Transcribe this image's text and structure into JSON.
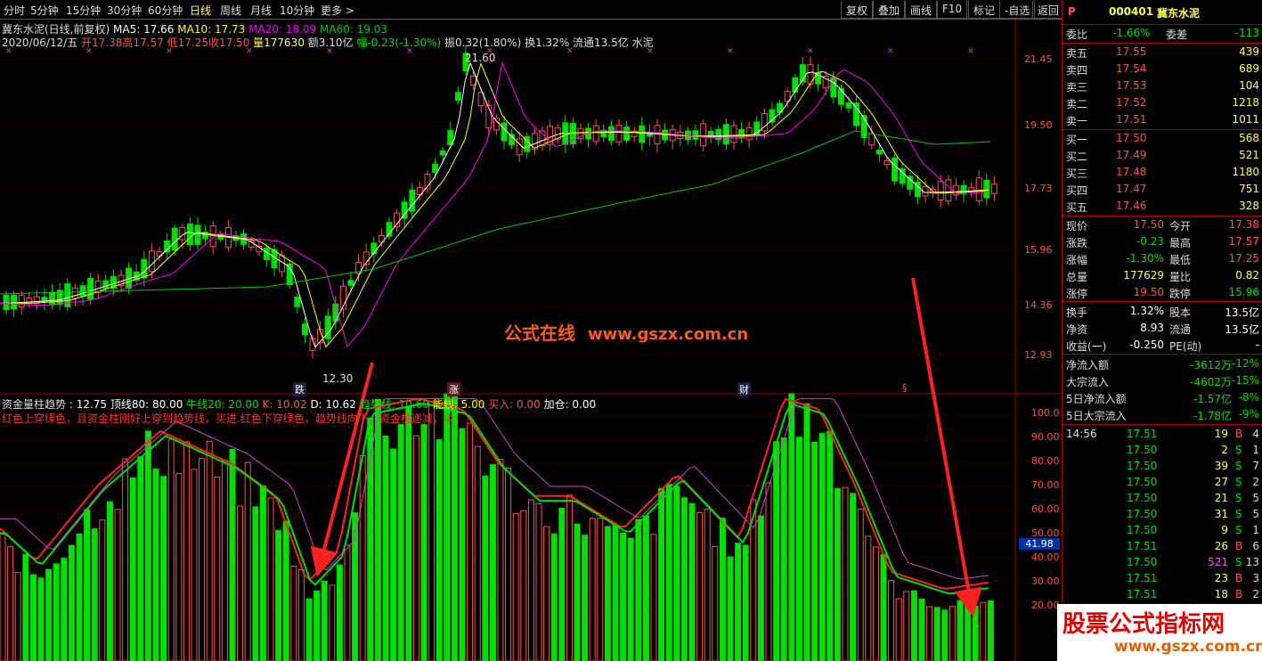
{
  "toolbar": {
    "tabs": [
      "分时",
      "5分钟",
      "15分钟",
      "30分钟",
      "60分钟",
      "日线",
      "周线",
      "月线",
      "10分钟",
      "更多 >"
    ],
    "active_tab": "日线",
    "right_buttons": [
      "复权",
      "叠加",
      "画线",
      "F10",
      "标记",
      "-自选",
      "返回"
    ]
  },
  "header": {
    "title": "冀东水泥(日线,前复权)",
    "ma5": "MA5: 17.66",
    "ma10": "MA10: 17.73",
    "ma20": "MA20: 18.09",
    "ma60": "MA60: 19.03",
    "date": "2020/06/12/五",
    "open": "开17.38",
    "high": "高17.57",
    "low": "低17.25",
    "close": "收17.50",
    "vol": "量177630",
    "amt": "额3.10亿",
    "chg": "幅-0.23(-1.30%)",
    "swing": "振0.32(1.80%)",
    "turnover": "换1.32%",
    "float": "流通13.5亿",
    "industry": "水泥"
  },
  "main_chart": {
    "y_ticks": [
      "21.45",
      "19.50",
      "17.73",
      "15.96",
      "14.36",
      "12.93"
    ],
    "high_label": "21.60",
    "low_label": "12.30",
    "events": [
      "跌",
      "涨",
      "财",
      "§"
    ],
    "colors": {
      "up": "#ff5050",
      "down": "#00e000",
      "ma5": "#ffffff",
      "ma10": "#ffff00",
      "ma20": "#ff00ff",
      "ma60": "#00cc00"
    }
  },
  "watermark_center": {
    "cn": "公式在线",
    "url": "www.gszx.com.cn"
  },
  "indicator": {
    "name": "资金量柱趋势",
    "v1": ": 12.75",
    "top": "顶线80: 80.00",
    "bull": "牛线20: 20.00",
    "k": "K: 10.02",
    "d": "D: 10.62",
    "trend": "趋势线: 10.60",
    "energy": "能线: 5.00",
    "buy": "买入: 0.00",
    "add": "加仓: 0.00",
    "note": "红色上穿绿色，且资金柱刚好上穿到趋势线，买进.红色下穿绿色，趋势线向下，资金柱递减，卖",
    "y_ticks": [
      "100.0",
      "90.00",
      "80.00",
      "70.00",
      "60.00",
      "50.00",
      "40.00",
      "30.00",
      "20.00"
    ],
    "current_value": "41.98"
  },
  "quote": {
    "marker": "P",
    "code": "000401",
    "name": "冀东水泥",
    "weibi_label": "委比",
    "weibi": "-1.66%",
    "weicha_label": "委差",
    "weicha": "-113",
    "asks": [
      {
        "label": "卖五",
        "price": "17.55",
        "vol": "439"
      },
      {
        "label": "卖四",
        "price": "17.54",
        "vol": "689"
      },
      {
        "label": "卖三",
        "price": "17.53",
        "vol": "104"
      },
      {
        "label": "卖二",
        "price": "17.52",
        "vol": "1218"
      },
      {
        "label": "卖一",
        "price": "17.51",
        "vol": "1011"
      }
    ],
    "bids": [
      {
        "label": "买一",
        "price": "17.50",
        "vol": "568"
      },
      {
        "label": "买二",
        "price": "17.49",
        "vol": "521"
      },
      {
        "label": "买三",
        "price": "17.48",
        "vol": "1180"
      },
      {
        "label": "买四",
        "price": "17.47",
        "vol": "751"
      },
      {
        "label": "买五",
        "price": "17.46",
        "vol": "328"
      }
    ],
    "stats": [
      {
        "l1": "现价",
        "v1": "17.50",
        "l2": "今开",
        "v2": "17.38"
      },
      {
        "l1": "涨跌",
        "v1": "-0.23",
        "l2": "最高",
        "v2": "17.57"
      },
      {
        "l1": "涨幅",
        "v1": "-1.30%",
        "l2": "最低",
        "v2": "17.25"
      },
      {
        "l1": "总量",
        "v1": "177629",
        "l2": "量比",
        "v2": "0.82"
      },
      {
        "l1": "涨停",
        "v1": "19.50",
        "l2": "跌停",
        "v2": "15.96"
      }
    ],
    "stats2": [
      {
        "l1": "换手",
        "v1": "1.32%",
        "l2": "股本",
        "v2": "13.5亿"
      },
      {
        "l1": "净资",
        "v1": "8.93",
        "l2": "流通",
        "v2": "13.5亿"
      },
      {
        "l1": "收益(一)",
        "v1": "-0.250",
        "l2": "PE(动)",
        "v2": "-"
      }
    ],
    "flows": [
      {
        "label": "净流入额",
        "value": "-3612万",
        "pct": "-12%"
      },
      {
        "label": "大宗流入",
        "value": "-4602万",
        "pct": "-15%"
      },
      {
        "label": "5日净流入额",
        "value": "-1.57亿",
        "pct": "-8%"
      },
      {
        "label": "5日大宗流入",
        "value": "-1.78亿",
        "pct": "-9%"
      }
    ],
    "ticks": [
      {
        "time": "14:56",
        "price": "17.51",
        "vol": "19",
        "bs": "B",
        "n": "4"
      },
      {
        "time": "",
        "price": "17.50",
        "vol": "2",
        "bs": "S",
        "n": "1"
      },
      {
        "time": "",
        "price": "17.50",
        "vol": "39",
        "bs": "S",
        "n": "7"
      },
      {
        "time": "",
        "price": "17.50",
        "vol": "27",
        "bs": "S",
        "n": "2"
      },
      {
        "time": "",
        "price": "17.50",
        "vol": "21",
        "bs": "S",
        "n": "5"
      },
      {
        "time": "",
        "price": "17.50",
        "vol": "31",
        "bs": "S",
        "n": "5"
      },
      {
        "time": "",
        "price": "17.50",
        "vol": "9",
        "bs": "S",
        "n": "1"
      },
      {
        "time": "",
        "price": "17.51",
        "vol": "26",
        "bs": "B",
        "n": "6"
      },
      {
        "time": "",
        "price": "17.50",
        "vol": "521",
        "bs": "S",
        "n": "13"
      },
      {
        "time": "",
        "price": "17.51",
        "vol": "23",
        "bs": "B",
        "n": "3"
      },
      {
        "time": "",
        "price": "17.51",
        "vol": "18",
        "bs": "B",
        "n": "2"
      }
    ]
  },
  "watermark_corner": {
    "cn": "股票公式指标网",
    "url": "www.gszx.com.cn"
  }
}
